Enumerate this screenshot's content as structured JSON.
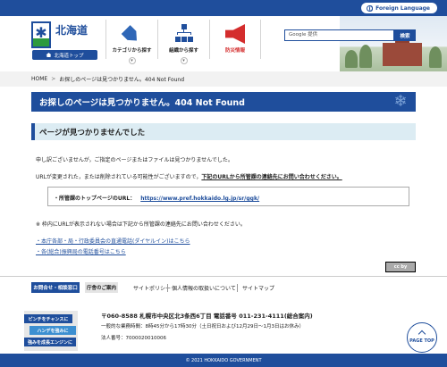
{
  "topbar": {
    "language_label": "Foreign Language"
  },
  "header": {
    "logo_text": "北海道",
    "top_link_label": "北海道トップ",
    "nav": [
      {
        "label": "カテゴリから探す",
        "icon": "tag-icon"
      },
      {
        "label": "組織から探す",
        "icon": "org-chart-icon"
      },
      {
        "label": "防災情報",
        "icon": "megaphone-icon"
      }
    ],
    "search": {
      "placeholder": "Google 提供",
      "button_label": "検索"
    }
  },
  "breadcrumb": {
    "home": "HOME",
    "separator": ">",
    "current": "お探しのページは見つかりません。404 Not Found"
  },
  "page_title": "お探しのページは見つかりません。404 Not Found",
  "content": {
    "section_heading": "ページが見つかりませんでした",
    "line1": "申し訳ございませんが，ご指定のページまたはファイルは見つかりませんでした。",
    "line2_prefix": "URLが変更された，または削除されている可能性がございますので，",
    "line2_underline": "下記のURLから所管課の連絡先にお問い合わせください。",
    "box_label": "所管課のトップページのURL：",
    "box_url": "https://www.pref.hokkaido.lg.jp/sr/ggk/",
    "note": "※ 枠内にURLが表示されない場合は下記から所管課の連絡先にお問い合わせください。",
    "links": [
      "本庁各部・局・行政委員会の直通電話(ダイヤルイン)はこちら",
      "各(総合)振興局の電話番号はこちら"
    ],
    "cc_badge": "cc by"
  },
  "footer_links": {
    "contact": "お問合せ・相談窓口",
    "guide": "庁舎のご案内",
    "policy": "サイトポリシー",
    "privacy": "個人情報の取扱いについて",
    "sitemap": "サイトマップ"
  },
  "footer": {
    "banner_lines": [
      "ピンチをチャンスに",
      "ハンデを強みに",
      "強みを成長エンジンに"
    ],
    "address": "〒060-8588 札幌市中央区北3条西6丁目  電話番号 011-231-4111(総合案内)",
    "hours": "一般的な業務時間：8時45分から17時30分（土日祝日および12月29日～1月3日はお休み）",
    "corporate_number": "法人番号：7000020010006",
    "pagetop_label": "PAGE TOP",
    "copyright": "© 2021 HOKKAIDO GOVERNMENT"
  },
  "colors": {
    "primary": "#1f4e9c",
    "heading_bg": "#dcecf3",
    "alert": "#d42d2d",
    "green": "#2d9a3e"
  }
}
